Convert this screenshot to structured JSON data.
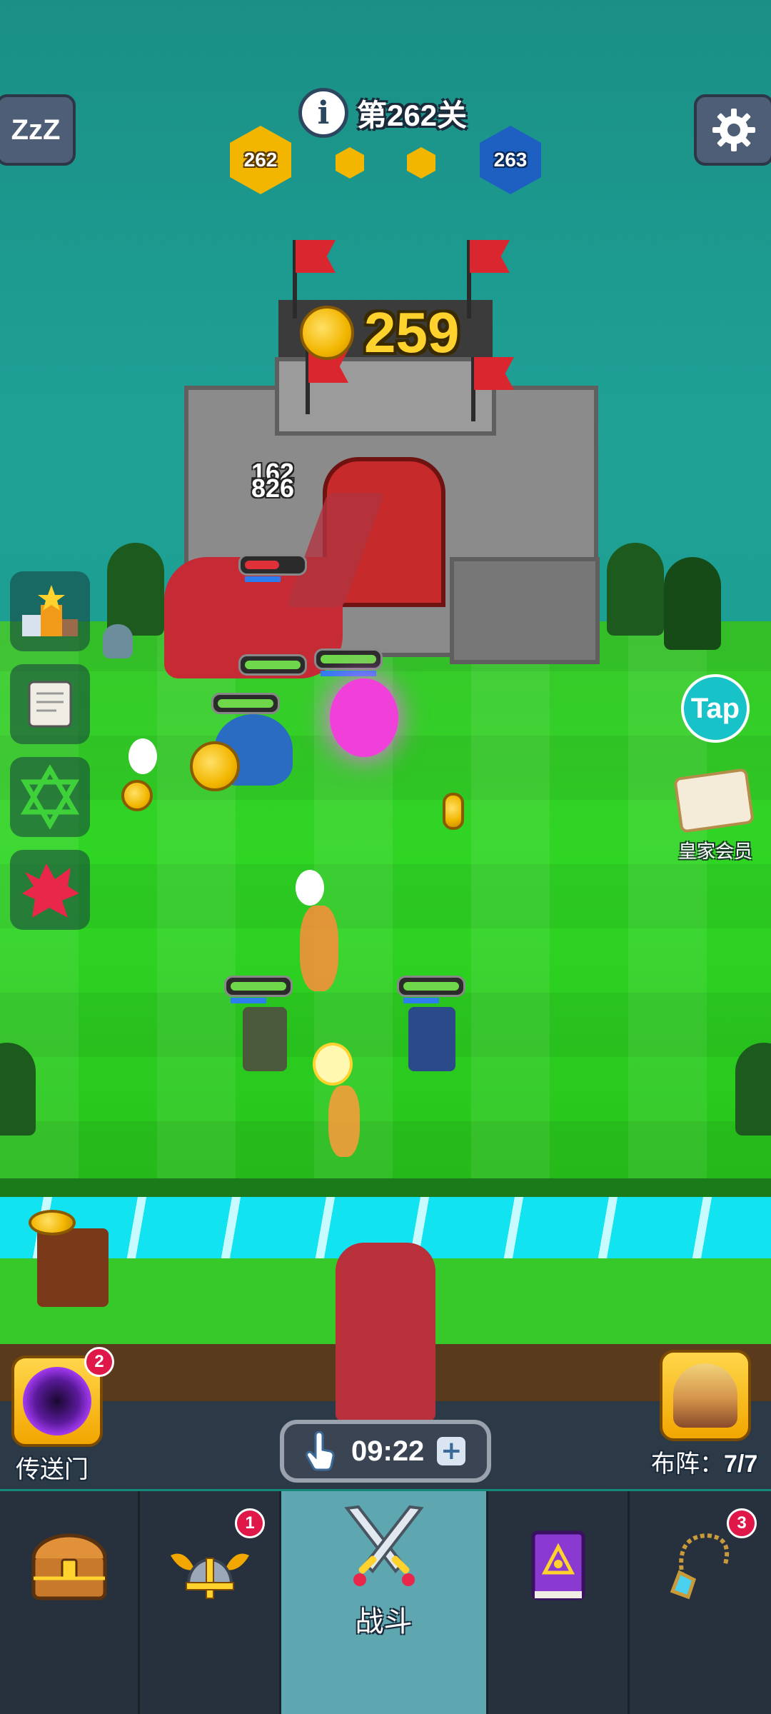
{
  "level": {
    "title": "第262关",
    "current": "262",
    "next": "263"
  },
  "battle": {
    "enemy_gold": "259",
    "damage_numbers": [
      "162",
      "826"
    ]
  },
  "side": {
    "tap_label": "Tap",
    "vip_label": "皇家会员"
  },
  "bottom": {
    "portal_label": "传送门",
    "portal_badge": "2",
    "lineup_label": "布阵：",
    "lineup_count": "7/7",
    "timer": "09:22"
  },
  "nav": {
    "items": [
      {
        "icon": "treasure-chest-icon",
        "label": "",
        "badge": ""
      },
      {
        "icon": "winged-helmet-icon",
        "label": "",
        "badge": "1"
      },
      {
        "icon": "crossed-swords-icon",
        "label": "战斗",
        "badge": ""
      },
      {
        "icon": "spell-book-icon",
        "label": "",
        "badge": ""
      },
      {
        "icon": "amulet-icon",
        "label": "",
        "badge": "3"
      }
    ]
  },
  "colors": {
    "accent_gold": "#ffd22e",
    "hex_current": "#f2b600",
    "hex_next": "#1e5fc2",
    "badge": "#e0184a",
    "active_tab": "#5ea7b0"
  }
}
